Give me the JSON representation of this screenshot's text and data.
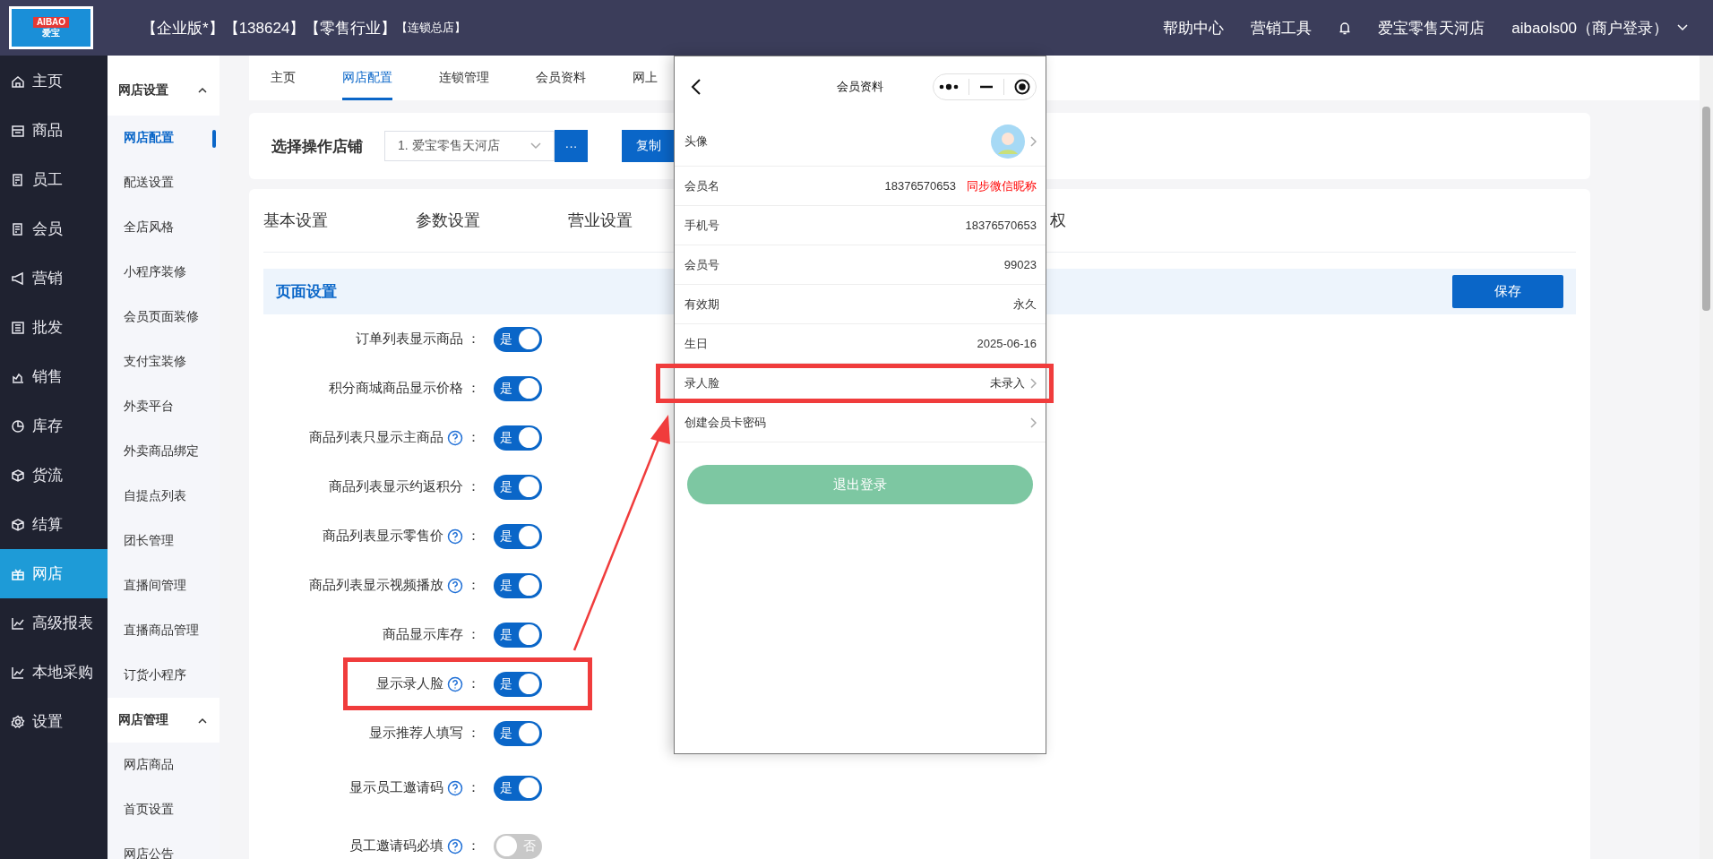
{
  "logo": {
    "top": "AIBAO",
    "bottom": "爱宝"
  },
  "header": {
    "titles": [
      "【企业版*】",
      "【138624】",
      "【零售行业】",
      "【连锁总店】"
    ],
    "links": [
      "帮助中心",
      "营销工具"
    ],
    "store": "爱宝零售天河店",
    "account": "aibaols00（商户登录）"
  },
  "sidebar": {
    "items": [
      {
        "label": "主页",
        "selected": false
      },
      {
        "label": "商品",
        "selected": false
      },
      {
        "label": "员工",
        "selected": false
      },
      {
        "label": "会员",
        "selected": false
      },
      {
        "label": "营销",
        "selected": false
      },
      {
        "label": "批发",
        "selected": false
      },
      {
        "label": "销售",
        "selected": false
      },
      {
        "label": "库存",
        "selected": false
      },
      {
        "label": "货流",
        "selected": false
      },
      {
        "label": "结算",
        "selected": false
      },
      {
        "label": "网店",
        "selected": true
      },
      {
        "label": "高级报表",
        "selected": false
      },
      {
        "label": "本地采购",
        "selected": false
      },
      {
        "label": "设置",
        "selected": false
      }
    ]
  },
  "submenu": [
    {
      "title": "网店设置",
      "expanded": true,
      "items": [
        {
          "label": "网店配置",
          "selected": true
        },
        {
          "label": "配送设置",
          "selected": false
        },
        {
          "label": "全店风格",
          "selected": false
        },
        {
          "label": "小程序装修",
          "selected": false
        },
        {
          "label": "会员页面装修",
          "selected": false
        },
        {
          "label": "支付宝装修",
          "selected": false
        },
        {
          "label": "外卖平台",
          "selected": false
        },
        {
          "label": "外卖商品绑定",
          "selected": false
        },
        {
          "label": "自提点列表",
          "selected": false
        },
        {
          "label": "团长管理",
          "selected": false
        },
        {
          "label": "直播间管理",
          "selected": false
        },
        {
          "label": "直播商品管理",
          "selected": false
        },
        {
          "label": "订货小程序",
          "selected": false
        }
      ]
    },
    {
      "title": "网店管理",
      "expanded": true,
      "items": [
        {
          "label": "网店商品",
          "selected": false
        },
        {
          "label": "首页设置",
          "selected": false
        },
        {
          "label": "网店公告",
          "selected": false
        }
      ]
    }
  ],
  "page_tabs": [
    {
      "label": "主页",
      "selected": false
    },
    {
      "label": "网店配置",
      "selected": true
    },
    {
      "label": "连锁管理",
      "selected": false
    },
    {
      "label": "会员资料",
      "selected": false
    },
    {
      "label": "网上",
      "selected": false
    }
  ],
  "store_select": {
    "label": "选择操作店铺",
    "value": "1. 爱宝零售天河店",
    "more": "···",
    "copy": "复制"
  },
  "settings_tabs": [
    "基本设置",
    "参数设置",
    "营业设置",
    "权"
  ],
  "section": {
    "title": "页面设置",
    "save": "保存"
  },
  "options": [
    {
      "label": "订单列表显示商品",
      "help": false,
      "colon": "：",
      "on": true,
      "text": "是",
      "highlighted": false
    },
    {
      "label": "积分商城商品显示价格",
      "help": false,
      "colon": "：",
      "on": true,
      "text": "是",
      "highlighted": false
    },
    {
      "label": "商品列表只显示主商品",
      "help": true,
      "colon": "：",
      "on": true,
      "text": "是",
      "highlighted": false
    },
    {
      "label": "商品列表显示约返积分",
      "help": false,
      "colon": "：",
      "on": true,
      "text": "是",
      "highlighted": false
    },
    {
      "label": "商品列表显示零售价",
      "help": true,
      "colon": "：",
      "on": true,
      "text": "是",
      "highlighted": false
    },
    {
      "label": "商品列表显示视频播放",
      "help": true,
      "colon": "：",
      "on": true,
      "text": "是",
      "highlighted": false
    },
    {
      "label": "商品显示库存",
      "help": false,
      "colon": "：",
      "on": true,
      "text": "是",
      "highlighted": false
    },
    {
      "label": "显示录人脸",
      "help": true,
      "colon": "：",
      "on": true,
      "text": "是",
      "highlighted": true
    },
    {
      "label": "显示推荐人填写",
      "help": false,
      "colon": "：",
      "on": true,
      "text": "是",
      "highlighted": false
    },
    {
      "label": "显示员工邀请码",
      "help": true,
      "colon": "：",
      "on": true,
      "text": "是",
      "highlighted": false
    },
    {
      "label": "员工邀请码必填",
      "help": true,
      "colon": "：",
      "on": false,
      "text": "否",
      "highlighted": false
    }
  ],
  "phone": {
    "title": "会员资料",
    "rows": [
      {
        "kind": "avatar",
        "label": "头像",
        "chevron": true,
        "highlighted": false
      },
      {
        "kind": "text",
        "label": "会员名",
        "value": "18376570653",
        "link": "同步微信昵称",
        "chevron": false,
        "highlighted": false
      },
      {
        "kind": "text",
        "label": "手机号",
        "value": "18376570653",
        "chevron": false,
        "highlighted": false
      },
      {
        "kind": "text",
        "label": "会员号",
        "value": "99023",
        "chevron": false,
        "highlighted": false
      },
      {
        "kind": "text",
        "label": "有效期",
        "value": "永久",
        "chevron": false,
        "highlighted": false
      },
      {
        "kind": "text",
        "label": "生日",
        "value": "2025-06-16",
        "chevron": false,
        "highlighted": false
      },
      {
        "kind": "text",
        "label": "录人脸",
        "value": "未录入",
        "chevron": true,
        "highlighted": true
      },
      {
        "kind": "text",
        "label": "创建会员卡密码",
        "chevron": true,
        "highlighted": false
      }
    ],
    "logout": "退出登录"
  }
}
